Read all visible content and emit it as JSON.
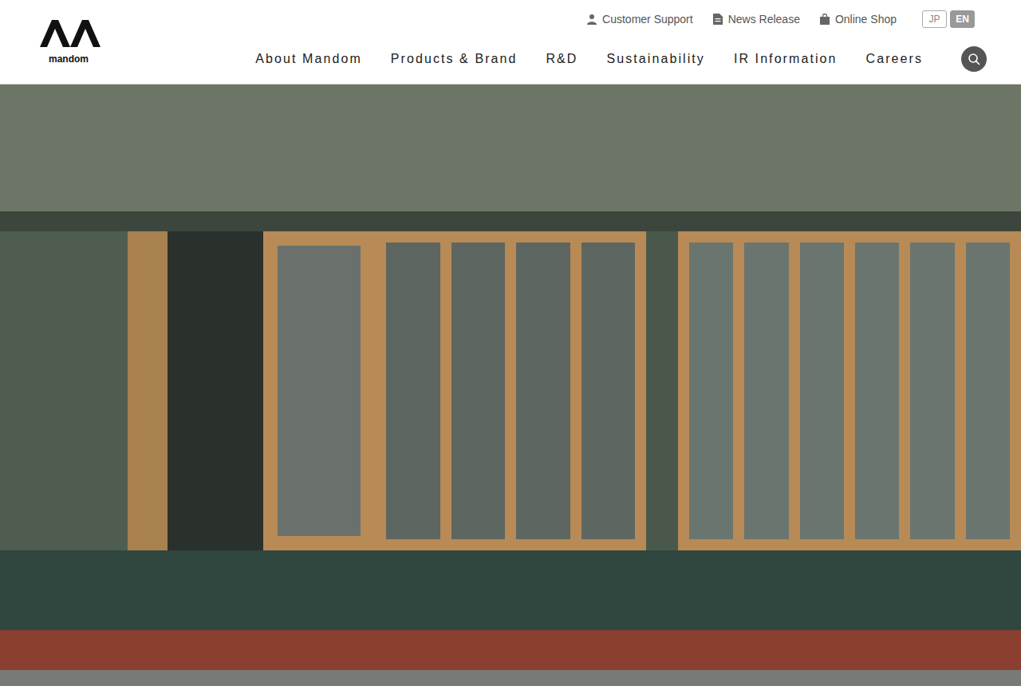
{
  "logo": {
    "text": "mandom"
  },
  "utility_links": [
    {
      "label": "Customer Support"
    },
    {
      "label": "News Release"
    },
    {
      "label": "Online Shop"
    }
  ],
  "languages": [
    {
      "label": "JP",
      "selected": false
    },
    {
      "label": "EN",
      "selected": true
    }
  ],
  "nav": [
    "About Mandom",
    "Products & Brand",
    "R&D",
    "Sustainability",
    "IR Information",
    "Careers"
  ]
}
